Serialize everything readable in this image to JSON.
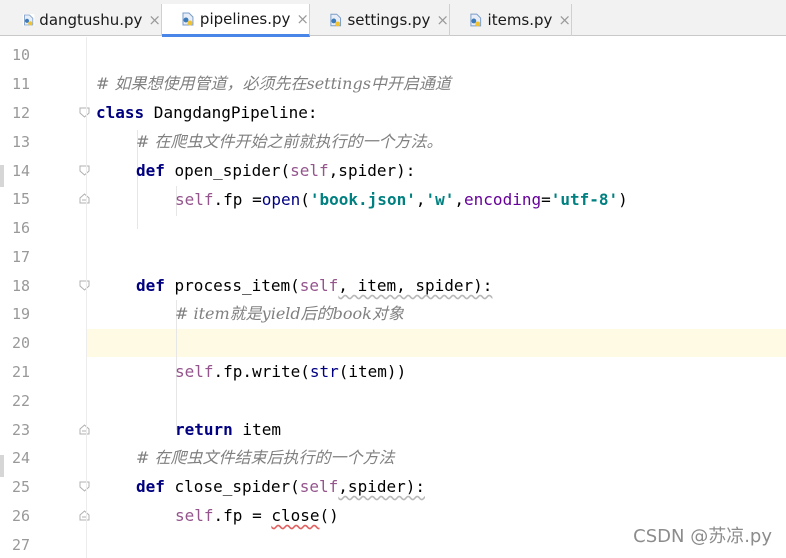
{
  "tabs": [
    {
      "label": "dangtushu.py",
      "close": "×"
    },
    {
      "label": "pipelines.py",
      "close": "×"
    },
    {
      "label": "settings.py",
      "close": "×"
    },
    {
      "label": "items.py",
      "close": "×"
    }
  ],
  "line_numbers": [
    "10",
    "11",
    "12",
    "13",
    "14",
    "15",
    "16",
    "17",
    "18",
    "19",
    "20",
    "21",
    "22",
    "23",
    "24",
    "25",
    "26",
    "27"
  ],
  "code": {
    "l11_comment": "# 如果想使用管道，必须先在settings中开启通道",
    "l12_kw": "class",
    "l12_name": " DangdangPipeline:",
    "l13_comment": "# 在爬虫文件开始之前就执行的一个方法。",
    "l14_kw": "def",
    "l14_fn": " open_spider(",
    "l14_self": "self",
    "l14_rest": ",spider):",
    "l15_self": "self",
    "l15_a": ".fp =",
    "l15_open": "open",
    "l15_b": "(",
    "l15_s1": "'book.json'",
    "l15_c": ",",
    "l15_s2": "'w'",
    "l15_d": ",",
    "l15_kwarg": "encoding",
    "l15_e": "=",
    "l15_s3": "'utf-8'",
    "l15_f": ")",
    "l18_kw": "def",
    "l18_fn": " process_item(",
    "l18_self": "self",
    "l18_rest": ", item, spider):",
    "l19_comment": "# item就是yield后的book对象",
    "l21_self": "self",
    "l21_a": ".fp.write(",
    "l21_str": "str",
    "l21_b": "(item))",
    "l23_kw": "return",
    "l23_rest": " item",
    "l24_comment": "# 在爬虫文件结束后执行的一个方法",
    "l25_kw": "def",
    "l25_fn": " close_spider(",
    "l25_self": "self",
    "l25_rest": ",spider):",
    "l26_self": "self",
    "l26_a": ".fp = ",
    "l26_close": "close",
    "l26_b": "()"
  },
  "watermark": "CSDN @苏凉.py",
  "colors": {
    "keyword": "#000080",
    "self": "#94558d",
    "comment": "#808080",
    "string": "#008080",
    "current_line": "#fffae3"
  }
}
